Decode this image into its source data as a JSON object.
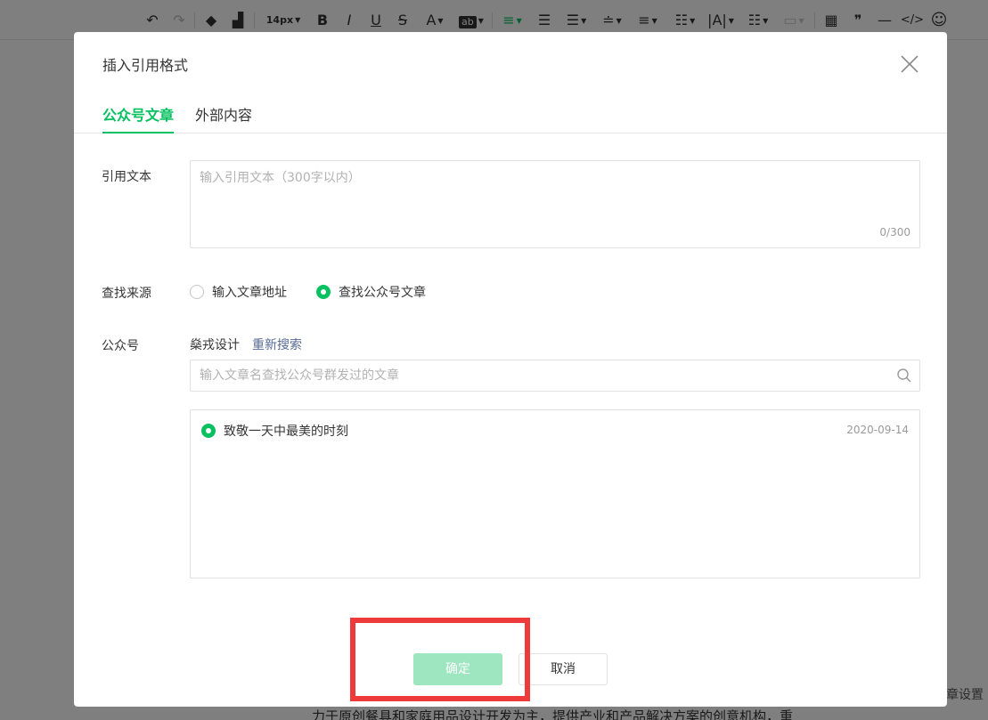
{
  "toolbar": {
    "undo": "↶",
    "redo": "↷",
    "font_size": "14px",
    "bold": "B",
    "italic": "I",
    "underline": "U",
    "strike": "S",
    "font_color": "A",
    "bg_color": "ab",
    "table": "▦",
    "quote": "❞",
    "hr": "—",
    "code": "</>",
    "emoji": "☺"
  },
  "editor": {
    "body_text": "力于原创餐具和家庭用品设计开发为主，提供产业和产品解决方案的创意机构，重",
    "side_link": "章设置"
  },
  "dialog": {
    "title": "插入引用格式",
    "tabs": [
      {
        "label": "公众号文章",
        "active": true
      },
      {
        "label": "外部内容",
        "active": false
      }
    ],
    "quote_label": "引用文本",
    "quote_placeholder": "输入引用文本（300字以内）",
    "quote_counter": "0/300",
    "source_label": "查找来源",
    "source_options": [
      {
        "label": "输入文章地址",
        "checked": false
      },
      {
        "label": "查找公众号文章",
        "checked": true
      }
    ],
    "account_label": "公众号",
    "account_name": "燊戎设计",
    "research_link": "重新搜索",
    "search_placeholder": "输入文章名查找公众号群发过的文章",
    "results": [
      {
        "title": "致敬一天中最美的时刻",
        "date": "2020-09-14",
        "selected": true
      }
    ],
    "confirm_label": "确定",
    "cancel_label": "取消"
  },
  "colors": {
    "accent": "#07c160",
    "link": "#576b95",
    "confirm_disabled": "#9ee6c0",
    "highlight": "#ee3a3a"
  }
}
